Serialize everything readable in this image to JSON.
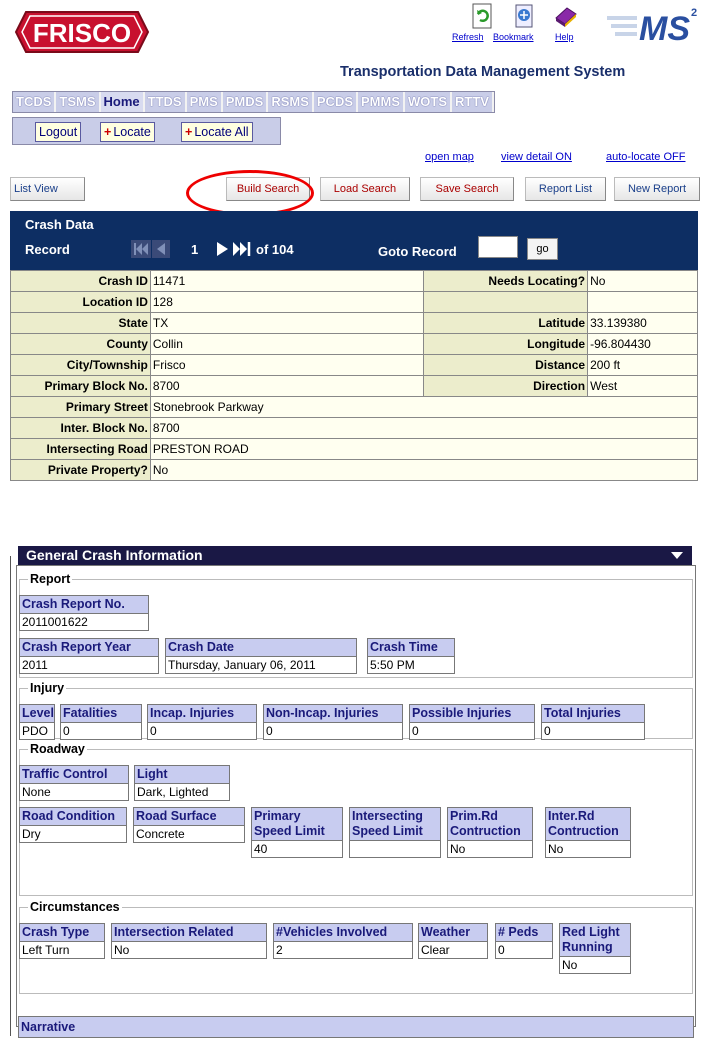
{
  "header": {
    "logo_text": "FRISCO",
    "tools": [
      {
        "icon": "refresh-icon",
        "label": "Refresh"
      },
      {
        "icon": "bookmark-icon",
        "label": "Bookmark"
      },
      {
        "icon": "help-icon",
        "label": "Help"
      }
    ],
    "brand_logo_text": "MS",
    "brand_logo_sup": "2",
    "system_title": "Transportation Data Management System"
  },
  "modules": [
    "TCDS",
    "TSMS",
    "Home",
    "TTDS",
    "PMS",
    "PMDS",
    "RSMS",
    "PCDS",
    "PMMS",
    "WOTS",
    "RTTV"
  ],
  "active_module": "Home",
  "actions": {
    "logout": "Logout",
    "locate": "Locate",
    "locate_all": "Locate All"
  },
  "links": {
    "open_map": "open map",
    "view_detail": "view detail ON",
    "auto_locate": "auto-locate OFF"
  },
  "buttons": {
    "list_view": "List View",
    "build_search": "Build Search",
    "load_search": "Load Search",
    "save_search": "Save Search",
    "report_list": "Report List",
    "new_report": "New Report"
  },
  "crash_data": {
    "title": "Crash Data",
    "record_label": "Record",
    "current_record": "1",
    "of_total": "of 104",
    "goto_label": "Goto Record",
    "goto_value": "",
    "go_label": "go",
    "rows": [
      {
        "l1": "Crash ID",
        "v1": "11471",
        "l2": "Needs Locating?",
        "v2": "No"
      },
      {
        "l1": "Location ID",
        "v1": "128",
        "l2": "",
        "v2": ""
      },
      {
        "l1": "State",
        "v1": "TX",
        "l2": "Latitude",
        "v2": "33.139380"
      },
      {
        "l1": "County",
        "v1": "Collin",
        "l2": "Longitude",
        "v2": "-96.804430"
      },
      {
        "l1": "City/Township",
        "v1": "Frisco",
        "l2": "Distance",
        "v2": "200 ft"
      },
      {
        "l1": "Primary Block No.",
        "v1": "8700",
        "l2": "Direction",
        "v2": "West"
      }
    ],
    "wide_rows": [
      {
        "l": "Primary Street",
        "v": "Stonebrook Parkway"
      },
      {
        "l": "Inter. Block No.",
        "v": "8700"
      },
      {
        "l": "Intersecting Road",
        "v": "PRESTON ROAD"
      },
      {
        "l": "Private Property?",
        "v": "No"
      }
    ]
  },
  "general": {
    "title": "General Crash Information",
    "report": {
      "legend": "Report",
      "report_no_label": "Crash Report No.",
      "report_no": "2011001622",
      "year_label": "Crash Report Year",
      "year": "2011",
      "date_label": "Crash Date",
      "date": "Thursday, January 06, 2011",
      "time_label": "Crash Time",
      "time": "5:50 PM"
    },
    "injury": {
      "legend": "Injury",
      "fields": [
        {
          "label": "Level",
          "value": "PDO"
        },
        {
          "label": "Fatalities",
          "value": "0"
        },
        {
          "label": "Incap. Injuries",
          "value": "0"
        },
        {
          "label": "Non-Incap. Injuries",
          "value": "0"
        },
        {
          "label": "Possible Injuries",
          "value": "0"
        },
        {
          "label": "Total Injuries",
          "value": "0"
        }
      ]
    },
    "roadway": {
      "legend": "Roadway",
      "traffic_control_label": "Traffic Control",
      "traffic_control": "None",
      "light_label": "Light",
      "light": "Dark, Lighted",
      "road_condition_label": "Road Condition",
      "road_condition": "Dry",
      "road_surface_label": "Road Surface",
      "road_surface": "Concrete",
      "primary_speed_label_1": "Primary",
      "primary_speed_label_2": "Speed Limit",
      "primary_speed": "40",
      "inter_speed_label_1": "Intersecting",
      "inter_speed_label_2": "Speed Limit",
      "inter_speed": "",
      "prim_construction_label_1": "Prim.Rd",
      "prim_construction_label_2": "Contruction",
      "prim_construction": "No",
      "inter_construction_label_1": "Inter.Rd",
      "inter_construction_label_2": "Contruction",
      "inter_construction": "No"
    },
    "circumstances": {
      "legend": "Circumstances",
      "crash_type_label": "Crash Type",
      "crash_type": "Left Turn",
      "intersection_label": "Intersection Related",
      "intersection": "No",
      "vehicles_label": "#Vehicles Involved",
      "vehicles": "2",
      "weather_label": "Weather",
      "weather": "Clear",
      "peds_label": "# Peds",
      "peds": "0",
      "red_light_label_1": "Red Light",
      "red_light_label_2": "Running",
      "red_light": "No"
    },
    "narrative_label": "Narrative"
  }
}
